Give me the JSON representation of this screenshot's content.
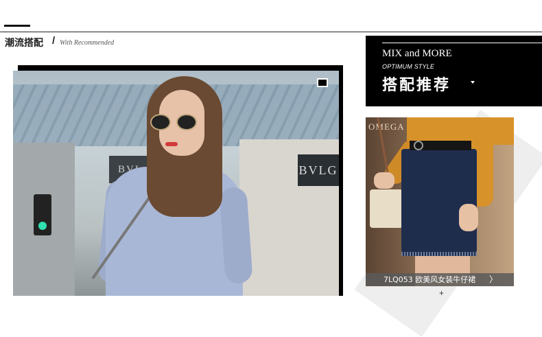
{
  "section": {
    "title": "潮流搭配",
    "separator": "/",
    "subtitle": "With Recommended"
  },
  "main_photo": {
    "shop_sign_right": "BVLG",
    "shop_sign_left": "BVL"
  },
  "banner": {
    "title": "MIX and MORE",
    "subtitle": "OPTIMUM STYLE",
    "heading": "搭配推荐"
  },
  "product": {
    "store_text": "OMEGA",
    "caption": "7LQ053 欧美风女装牛仔裙",
    "chevron": "〉"
  },
  "plus": "+"
}
